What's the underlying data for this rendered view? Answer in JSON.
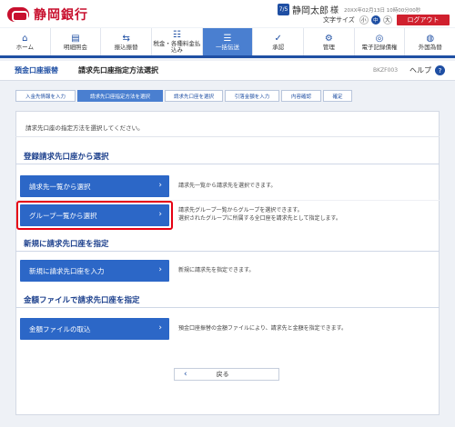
{
  "header": {
    "bank_name": "静岡銀行",
    "user_badge": "7/5",
    "user_name": "静岡太郎",
    "user_suffix": "様",
    "datetime": "20XX年02月13日 10時00分00秒",
    "font_size_label": "文字サイズ",
    "font_sizes": [
      "小",
      "中",
      "大"
    ],
    "font_size_selected": "中",
    "logout_label": "ログアウト"
  },
  "nav": {
    "items": [
      {
        "label": "ホーム",
        "icon": "home-icon",
        "glyph": "⌂"
      },
      {
        "label": "明細照会",
        "icon": "document-icon",
        "glyph": "▤"
      },
      {
        "label": "振込振替",
        "icon": "transfer-icon",
        "glyph": "⇆"
      },
      {
        "label": "税金・各種料金払込み",
        "icon": "payment-icon",
        "glyph": "☷"
      },
      {
        "label": "一括伝送",
        "icon": "stack-icon",
        "glyph": "☰"
      },
      {
        "label": "承認",
        "icon": "approve-icon",
        "glyph": "✓"
      },
      {
        "label": "管理",
        "icon": "manage-icon",
        "glyph": "⚙"
      },
      {
        "label": "電子記録債権",
        "icon": "e-bond-icon",
        "glyph": "◎"
      },
      {
        "label": "外国為替",
        "icon": "globe-icon",
        "glyph": "◍"
      }
    ],
    "active_index": 4
  },
  "page": {
    "category": "預金口座振替",
    "title": "請求先口座指定方法選択",
    "screen_code": "BKZF003",
    "help_label": "ヘルプ",
    "help_icon": "?"
  },
  "steps": [
    {
      "label": "入金先情報を入力",
      "active": false
    },
    {
      "label": "請求先口座指定方法を選択",
      "active": true
    },
    {
      "label": "請求先口座を選択",
      "active": false
    },
    {
      "label": "引落金額を入力",
      "active": false
    },
    {
      "label": "内容確認",
      "active": false
    },
    {
      "label": "確定",
      "active": false
    }
  ],
  "main": {
    "intro": "請求先口座の指定方法を選択してください。",
    "sections": [
      {
        "title": "登録請求先口座から選択",
        "options": [
          {
            "label": "請求先一覧から選択",
            "desc": [
              "請求先一覧から請求先を選択できます。"
            ]
          },
          {
            "label": "グループ一覧から選択",
            "desc": [
              "請求先グループ一覧からグループを選択できます。",
              "選択されたグループに所属する全口座を請求先として指定します。"
            ],
            "highlighted": true
          }
        ]
      },
      {
        "title": "新規に請求先口座を指定",
        "options": [
          {
            "label": "新規に請求先口座を入力",
            "desc": [
              "新規に請求先を指定できます。"
            ]
          }
        ]
      },
      {
        "title": "金額ファイルで請求先口座を指定",
        "options": [
          {
            "label": "金額ファイルの取込",
            "desc": [
              "預金口座振替の金額ファイルにより、請求先と金額を指定できます。"
            ]
          }
        ]
      }
    ],
    "back_label": "戻る"
  },
  "colors": {
    "brand_red": "#c8102e",
    "primary_blue": "#2c67c7",
    "nav_active": "#4a7fd0",
    "highlight_red": "#e60012"
  }
}
